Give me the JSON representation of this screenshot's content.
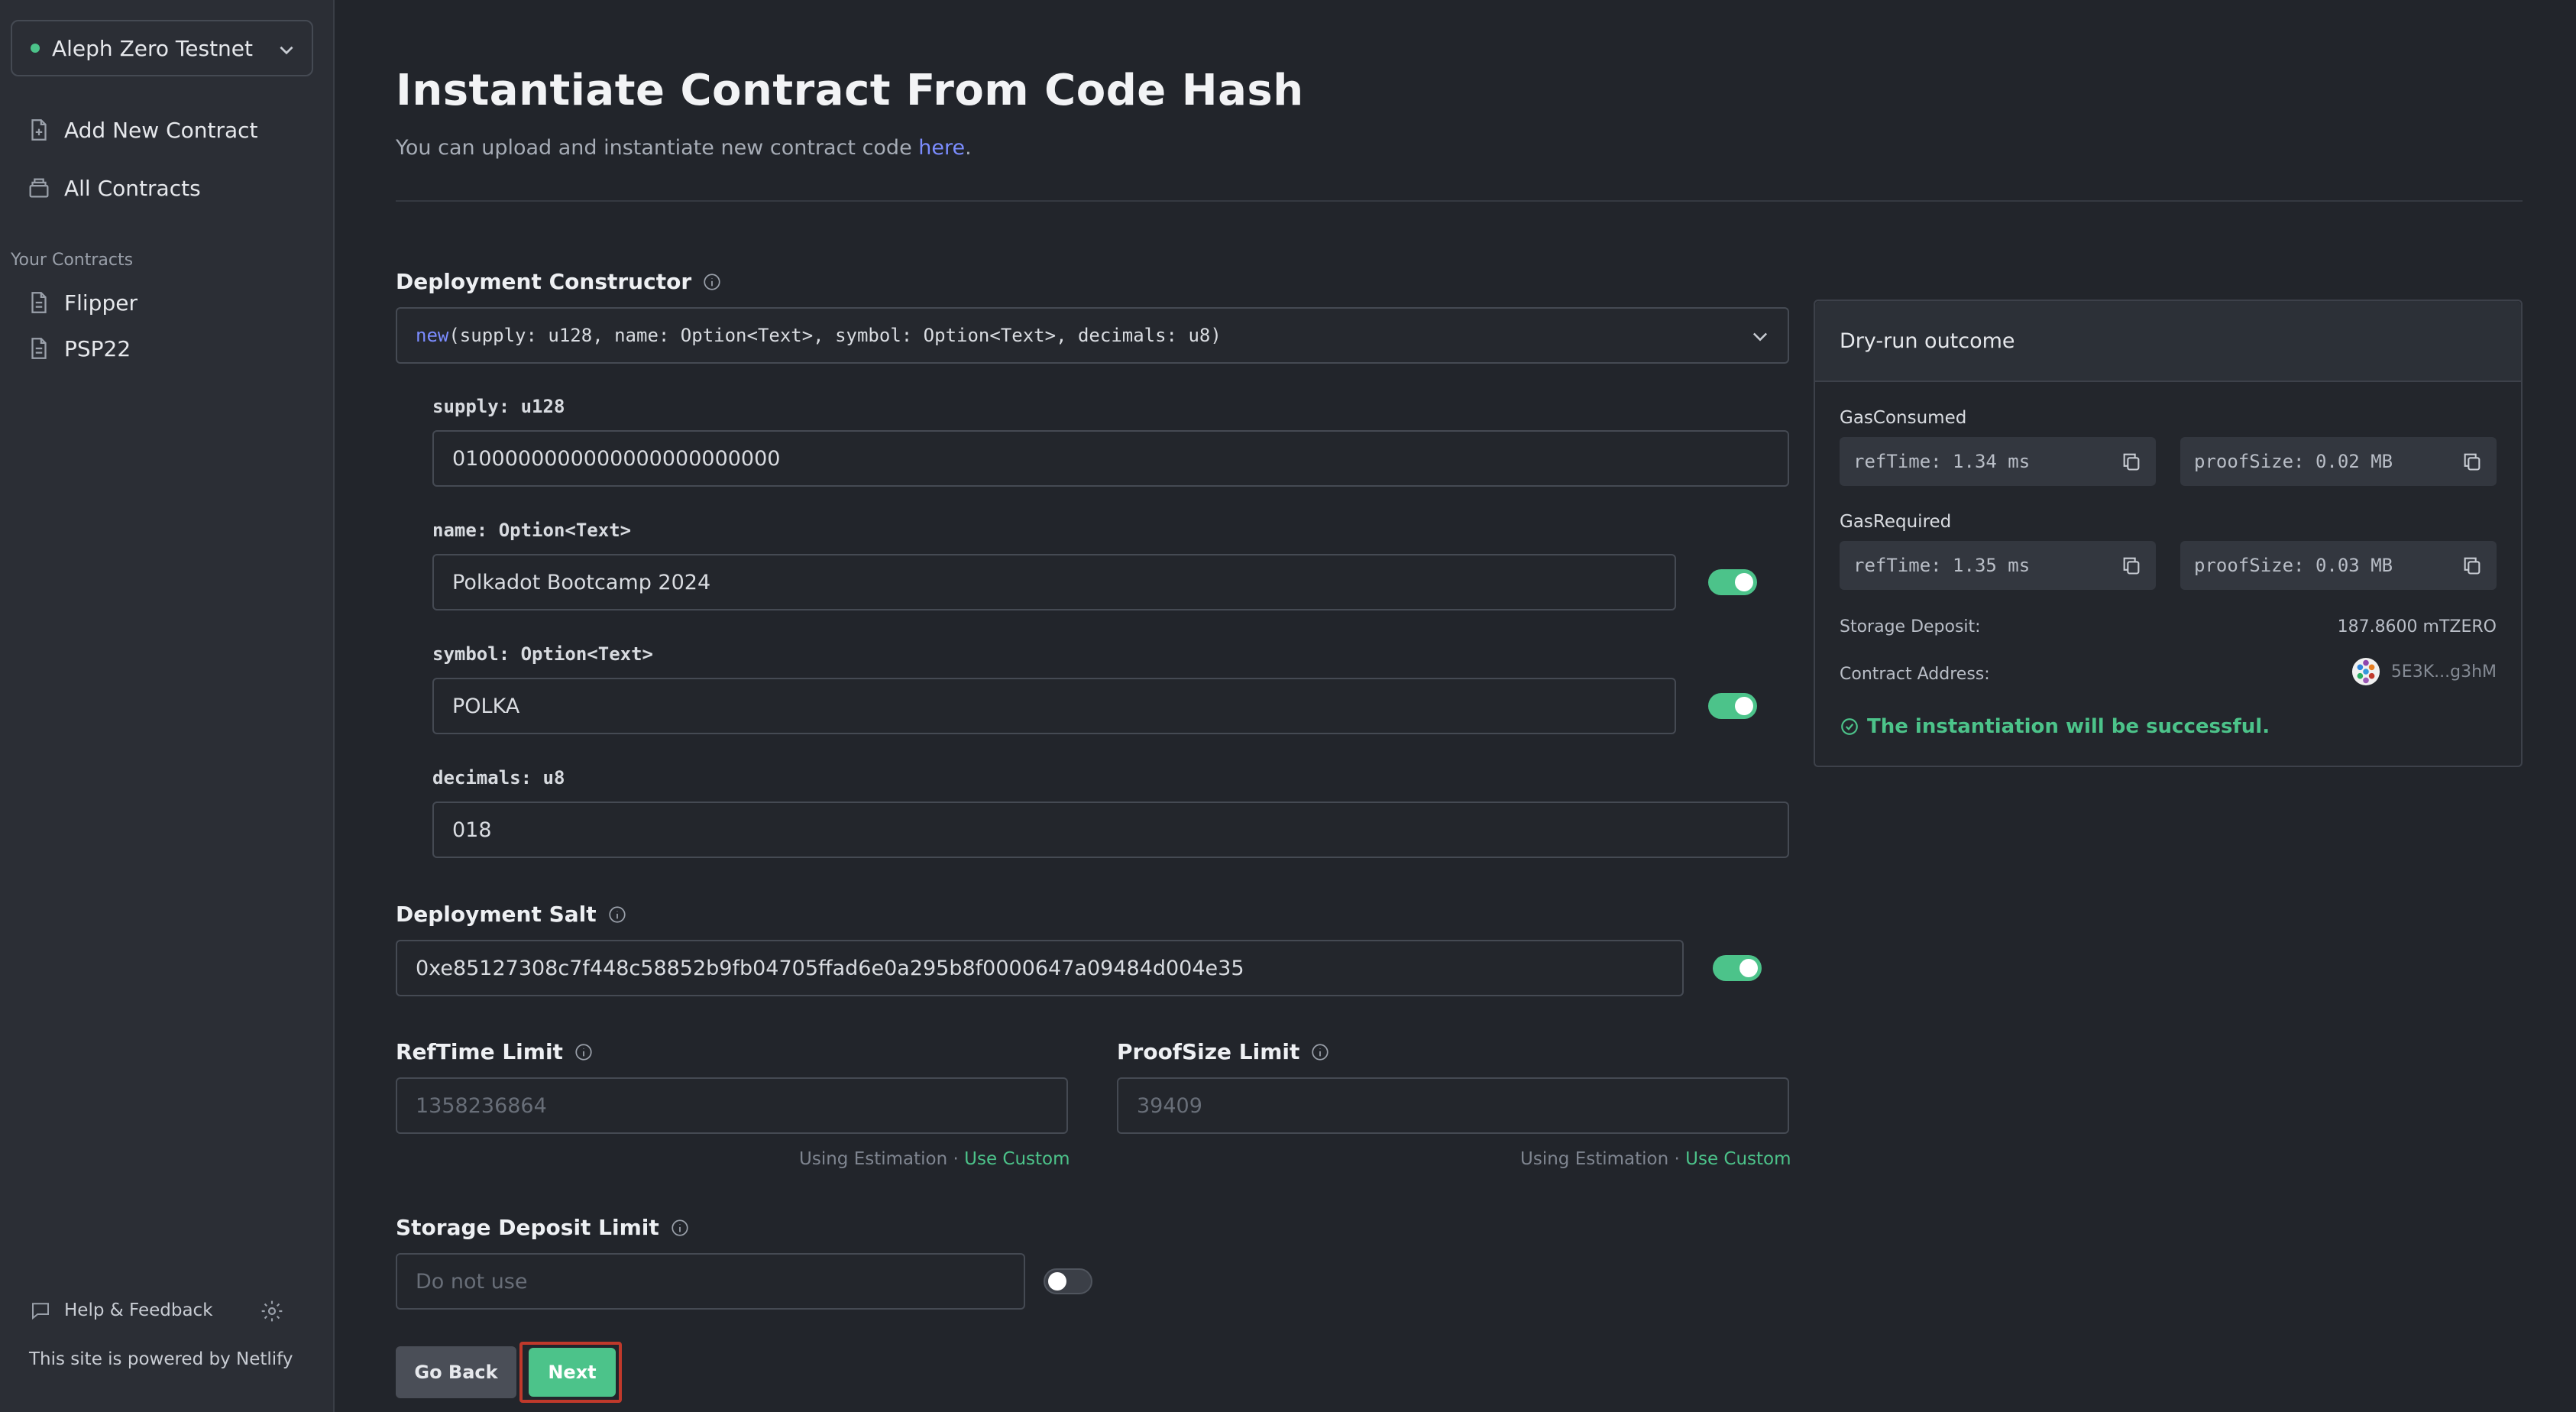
{
  "sidebar": {
    "network": "Aleph Zero Testnet",
    "nav": [
      {
        "label": "Add New Contract",
        "icon": "file-plus-icon"
      },
      {
        "label": "All Contracts",
        "icon": "stack-icon"
      }
    ],
    "section_label": "Your Contracts",
    "contracts": [
      {
        "label": "Flipper",
        "icon": "document-icon"
      },
      {
        "label": "PSP22",
        "icon": "document-icon"
      }
    ],
    "help_label": "Help & Feedback",
    "powered_by": "This site is powered by Netlify"
  },
  "main": {
    "title": "Instantiate Contract From Code Hash",
    "subtitle_prefix": "You can upload and instantiate new contract code ",
    "subtitle_link": "here",
    "subtitle_suffix": ".",
    "constructor_label": "Deployment Constructor",
    "constructor_keyword": "new",
    "constructor_signature": "(supply: u128, name: Option<Text>, symbol: Option<Text>, decimals: u8)",
    "args": {
      "supply_label": "supply: u128",
      "supply_value": "0100000000000000000000000",
      "name_label": "name: Option<Text>",
      "name_value": "Polkadot Bootcamp 2024",
      "symbol_label": "symbol: Option<Text>",
      "symbol_value": "POLKA",
      "decimals_label": "decimals: u8",
      "decimals_value": "018"
    },
    "salt_label": "Deployment Salt",
    "salt_value": "0xe85127308c7f448c58852b9fb04705ffad6e0a295b8f0000647a09484d004e35",
    "reftime_label": "RefTime Limit",
    "reftime_placeholder": "1358236864",
    "proofsize_label": "ProofSize Limit",
    "proofsize_placeholder": "39409",
    "using_estimation": "Using Estimation",
    "separator": "·",
    "use_custom": "Use Custom",
    "storage_label": "Storage Deposit Limit",
    "storage_placeholder": "Do not use",
    "back_label": "Go Back",
    "next_label": "Next"
  },
  "dry_run": {
    "title": "Dry-run outcome",
    "gas_consumed_label": "GasConsumed",
    "gas_consumed_reftime": "refTime: 1.34 ms",
    "gas_consumed_proofsize": "proofSize: 0.02 MB",
    "gas_required_label": "GasRequired",
    "gas_required_reftime": "refTime: 1.35 ms",
    "gas_required_proofsize": "proofSize: 0.03 MB",
    "storage_deposit_label": "Storage Deposit:",
    "storage_deposit_value": "187.8600 mTZERO",
    "contract_address_label": "Contract Address:",
    "contract_address_value": "5E3K...g3hM",
    "success_message": "The instantiation will be successful."
  },
  "colors": {
    "accent_green": "#4cc38a",
    "link_blue": "#7b8cff",
    "highlight_red": "#c0392b"
  }
}
